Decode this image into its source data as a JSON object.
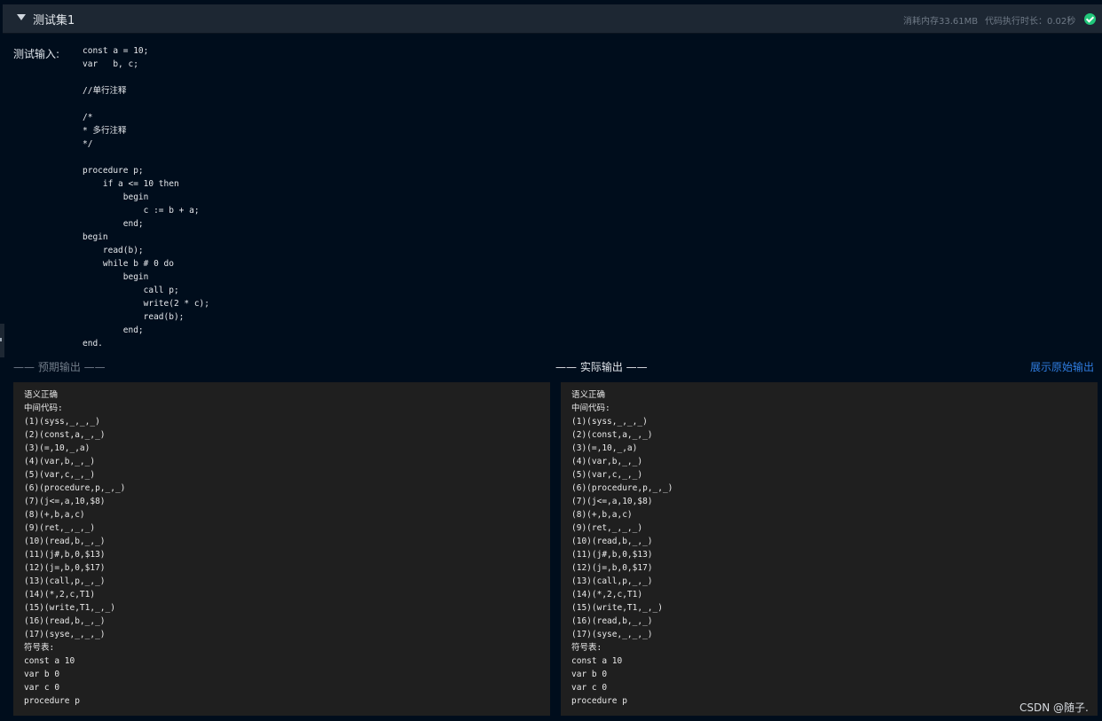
{
  "header": {
    "title": "测试集1",
    "memory": "消耗内存33.61MB",
    "exec_time": "代码执行时长：0.02秒"
  },
  "input": {
    "label": "测试输入:",
    "code": "const a = 10;\nvar   b, c;\n\n//单行注释\n\n/*\n* 多行注释\n*/\n\nprocedure p;\n    if a <= 10 then\n        begin\n            c := b + a;\n        end;\nbegin\n    read(b);\n    while b # 0 do\n        begin\n            call p;\n            write(2 * c);\n            read(b);\n        end;\nend."
  },
  "expected": {
    "label": "—— 预期输出 ——",
    "output": "语义正确\n中间代码:\n(1)(syss,_,_,_)\n(2)(const,a,_,_)\n(3)(=,10,_,a)\n(4)(var,b,_,_)\n(5)(var,c,_,_)\n(6)(procedure,p,_,_)\n(7)(j<=,a,10,$8)\n(8)(+,b,a,c)\n(9)(ret,_,_,_)\n(10)(read,b,_,_)\n(11)(j#,b,0,$13)\n(12)(j=,b,0,$17)\n(13)(call,p,_,_)\n(14)(*,2,c,T1)\n(15)(write,T1,_,_)\n(16)(read,b,_,_)\n(17)(syse,_,_,_)\n符号表:\nconst a 10\nvar b 0\nvar c 0\nprocedure p"
  },
  "actual": {
    "label": "—— 实际输出 ——",
    "show_raw": "展示原始输出",
    "output": "语义正确\n中间代码:\n(1)(syss,_,_,_)\n(2)(const,a,_,_)\n(3)(=,10,_,a)\n(4)(var,b,_,_)\n(5)(var,c,_,_)\n(6)(procedure,p,_,_)\n(7)(j<=,a,10,$8)\n(8)(+,b,a,c)\n(9)(ret,_,_,_)\n(10)(read,b,_,_)\n(11)(j#,b,0,$13)\n(12)(j=,b,0,$17)\n(13)(call,p,_,_)\n(14)(*,2,c,T1)\n(15)(write,T1,_,_)\n(16)(read,b,_,_)\n(17)(syse,_,_,_)\n符号表:\nconst a 10\nvar b 0\nvar c 0\nprocedure p"
  },
  "watermark": "CSDN @随子.",
  "icons": {
    "collapse": "caret-down-icon",
    "status": "check-circle-icon",
    "side": "side-handle-icon"
  },
  "colors": {
    "status_ok": "#21c77a",
    "link": "#2f7de1",
    "background": "#000d1c"
  }
}
